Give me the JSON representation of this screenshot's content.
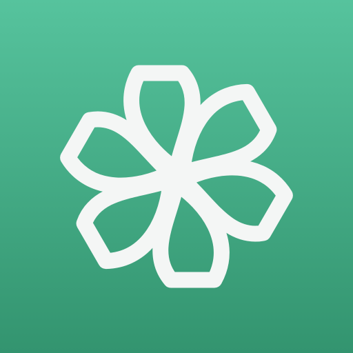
{
  "icon": {
    "name": "pinwheel-flower-icon",
    "colors": {
      "gradient_top": "#56c39d",
      "gradient_bottom": "#33946f",
      "glyph": "#f4f6f5"
    }
  }
}
